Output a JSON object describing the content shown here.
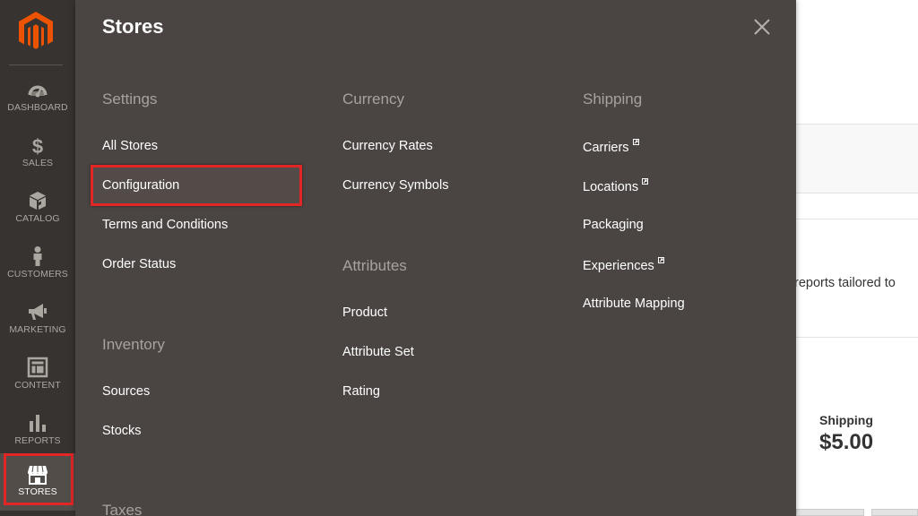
{
  "background": {
    "reports_text": "reports tailored to",
    "shipping_label": "Shipping",
    "shipping_value": "$5.00"
  },
  "nav": {
    "items": [
      {
        "label": "DASHBOARD",
        "icon": "dashboard-icon"
      },
      {
        "label": "SALES",
        "icon": "dollar-icon"
      },
      {
        "label": "CATALOG",
        "icon": "cube-icon"
      },
      {
        "label": "CUSTOMERS",
        "icon": "person-icon"
      },
      {
        "label": "MARKETING",
        "icon": "megaphone-icon"
      },
      {
        "label": "CONTENT",
        "icon": "layout-icon"
      },
      {
        "label": "REPORTS",
        "icon": "bar-chart-icon"
      },
      {
        "label": "STORES",
        "icon": "storefront-icon"
      }
    ],
    "active": "STORES"
  },
  "panel": {
    "title": "Stores",
    "columns": [
      {
        "sections": [
          {
            "title": "Settings",
            "links": [
              "All Stores",
              "Configuration",
              "Terms and Conditions",
              "Order Status"
            ]
          },
          {
            "title": "Inventory",
            "links": [
              "Sources",
              "Stocks"
            ]
          },
          {
            "title": "Taxes",
            "links": []
          }
        ]
      },
      {
        "sections": [
          {
            "title": "Currency",
            "links": [
              "Currency Rates",
              "Currency Symbols"
            ]
          },
          {
            "title": "Attributes",
            "links": [
              "Product",
              "Attribute Set",
              "Rating"
            ]
          }
        ]
      },
      {
        "sections": [
          {
            "title": "Shipping",
            "links": [
              "Carriers",
              "Locations",
              "Packaging",
              "Experiences",
              "Attribute Mapping"
            ]
          }
        ]
      }
    ]
  },
  "colors": {
    "nav_bg": "#373330",
    "panel_bg": "#4a4542",
    "highlight": "#e22626",
    "logo": "#eb5202"
  }
}
